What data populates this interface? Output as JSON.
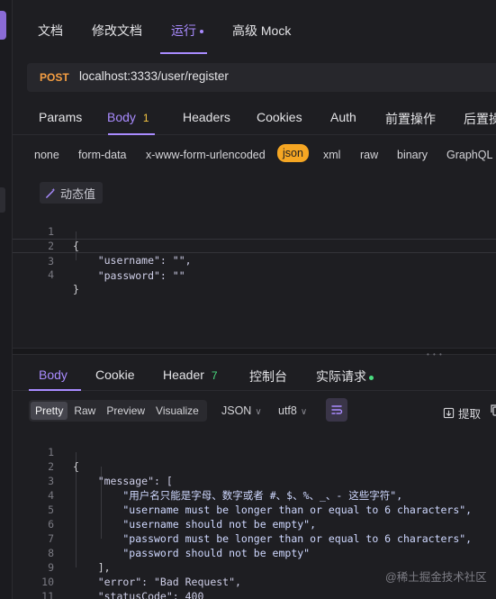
{
  "top_tabs": [
    {
      "label": "文档"
    },
    {
      "label": "修改文档"
    },
    {
      "label": "运行"
    },
    {
      "label": "高级 Mock"
    }
  ],
  "request": {
    "method": "POST",
    "url": "localhost:3333/user/register"
  },
  "req_tabs": [
    {
      "label": "Params",
      "count": ""
    },
    {
      "label": "Body",
      "count": "1"
    },
    {
      "label": "Headers",
      "count": ""
    },
    {
      "label": "Cookies",
      "count": ""
    },
    {
      "label": "Auth",
      "count": ""
    },
    {
      "label": "前置操作",
      "count": ""
    },
    {
      "label": "后置操"
    }
  ],
  "body_types": [
    "none",
    "form-data",
    "x-www-form-urlencoded",
    "json",
    "xml",
    "raw",
    "binary",
    "GraphQL"
  ],
  "body_type_selected": "json",
  "dynamic_value_label": "动态值",
  "request_body_lines": [
    {
      "n": "1",
      "text": "{"
    },
    {
      "n": "2",
      "text": "    \"username\": \"\","
    },
    {
      "n": "3",
      "text": "    \"password\": \"\""
    },
    {
      "n": "4",
      "text": "}"
    }
  ],
  "resp_tabs": [
    {
      "label": "Body",
      "count": ""
    },
    {
      "label": "Cookie",
      "count": ""
    },
    {
      "label": "Header",
      "count": "7"
    },
    {
      "label": "控制台",
      "count": ""
    },
    {
      "label": "实际请求",
      "count": ""
    }
  ],
  "view_modes": [
    "Pretty",
    "Raw",
    "Preview",
    "Visualize"
  ],
  "view_mode_selected": "Pretty",
  "format_select": "JSON",
  "encoding_select": "utf8",
  "extract_label": "提取",
  "response_lines": [
    {
      "n": "1",
      "text": "{"
    },
    {
      "n": "2",
      "text": "    \"message\": ["
    },
    {
      "n": "3",
      "text": "        \"用户名只能是字母、数字或者 #、$、%、_、- 这些字符\","
    },
    {
      "n": "4",
      "text": "        \"username must be longer than or equal to 6 characters\","
    },
    {
      "n": "5",
      "text": "        \"username should not be empty\","
    },
    {
      "n": "6",
      "text": "        \"password must be longer than or equal to 6 characters\","
    },
    {
      "n": "7",
      "text": "        \"password should not be empty\""
    },
    {
      "n": "8",
      "text": "    ],"
    },
    {
      "n": "9",
      "text": "    \"error\": \"Bad Request\","
    },
    {
      "n": "10",
      "text": "    \"statusCode\": 400"
    },
    {
      "n": "11",
      "text": "}"
    }
  ],
  "watermark": "@稀土掘金技术社区",
  "colors": {
    "accent": "#a98bff",
    "method_post": "#f59e42",
    "json_pill": "#f5a623",
    "success_dot": "#4ade80",
    "background": "#1e1e22"
  }
}
